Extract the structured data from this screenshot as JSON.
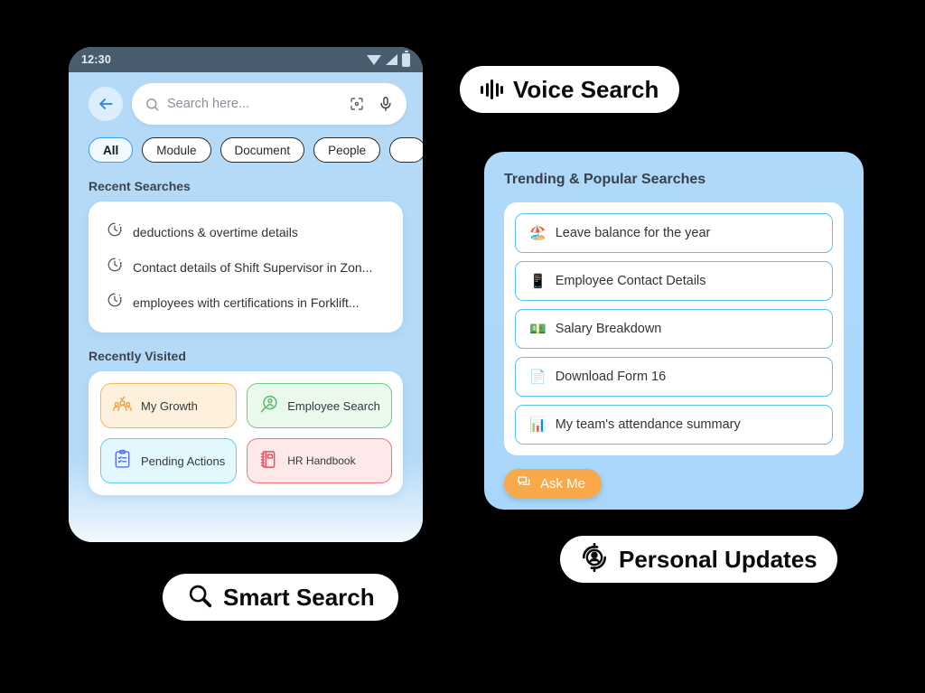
{
  "phone": {
    "status_bar": {
      "time": "12:30",
      "icons": [
        "wifi-icon",
        "signal-icon",
        "battery-icon"
      ]
    },
    "search": {
      "back_icon": "back-arrow-icon",
      "search_icon": "search-icon",
      "placeholder": "Search here...",
      "lens_icon": "lens-scan-icon",
      "mic_icon": "microphone-icon"
    },
    "filter_chips": [
      {
        "label": "All",
        "active": true
      },
      {
        "label": "Module",
        "active": false
      },
      {
        "label": "Document",
        "active": false
      },
      {
        "label": "People",
        "active": false
      },
      {
        "label": "",
        "active": false
      }
    ],
    "recent_searches": {
      "title": "Recent Searches",
      "items": [
        {
          "icon": "history-clock-icon",
          "label": "deductions & overtime details"
        },
        {
          "icon": "history-clock-icon",
          "label": "Contact details of Shift Supervisor in Zon..."
        },
        {
          "icon": "history-clock-icon",
          "label": "employees with certifications in Forklift..."
        }
      ]
    },
    "recently_visited": {
      "title": "Recently Visited",
      "tiles": [
        {
          "label": "My Growth",
          "icon": "people-growth-icon",
          "color": "#f0a23c",
          "theme": "orange"
        },
        {
          "label": "Employee Search",
          "icon": "person-search-icon",
          "color": "#4fb963",
          "theme": "green"
        },
        {
          "label": "Pending Actions",
          "icon": "clipboard-check-icon",
          "color": "#5b6ef0",
          "theme": "blue"
        },
        {
          "label": "HR Handbook",
          "icon": "notebook-icon",
          "color": "#f04b57",
          "theme": "red"
        }
      ]
    }
  },
  "right_panel": {
    "title": "Trending & Popular Searches",
    "items": [
      {
        "emoji": "🏖️",
        "icon": "beach-umbrella-icon",
        "label": "Leave balance for the year"
      },
      {
        "emoji": "📱",
        "icon": "mobile-phone-icon",
        "label": "Employee Contact Details"
      },
      {
        "emoji": "💵",
        "icon": "money-icon",
        "label": "Salary Breakdown"
      },
      {
        "emoji": "📄",
        "icon": "document-page-icon",
        "label": "Download Form 16"
      },
      {
        "emoji": "📊",
        "icon": "bar-chart-icon",
        "label": "My team's attendance summary"
      }
    ],
    "ask_me": {
      "label": "Ask Me",
      "icon": "chat-bubbles-icon",
      "color": "#f9a94a"
    }
  },
  "labels": {
    "voice_search": {
      "text": "Voice Search",
      "icon": "voice-waveform-icon"
    },
    "smart_search": {
      "text": "Smart Search",
      "icon": "magnifier-icon"
    },
    "personal_updates": {
      "text": "Personal Updates",
      "icon": "person-refresh-icon"
    }
  },
  "colors": {
    "screen_bg": "#b4daf8",
    "panel_bg": "#aed9fb",
    "accent_blue": "#3b9bf0",
    "accent_orange": "#f9a94a",
    "status_bar": "#4a5d6e"
  }
}
